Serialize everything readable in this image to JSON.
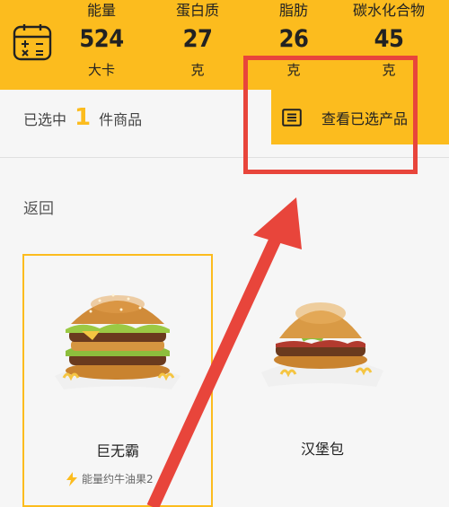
{
  "nutrition": {
    "stats": [
      {
        "label": "能量",
        "value": "524",
        "unit": "大卡"
      },
      {
        "label": "蛋白质",
        "value": "27",
        "unit": "克"
      },
      {
        "label": "脂肪",
        "value": "26",
        "unit": "克"
      },
      {
        "label": "碳水化合物",
        "value": "45",
        "unit": "克"
      }
    ],
    "icon": "calculator-icon",
    "bg_color": "#FCBC1E"
  },
  "selection": {
    "prefix": "已选中",
    "count": "1",
    "suffix": "件商品",
    "view_button_label": "查看已选产品",
    "view_button_icon": "list-icon"
  },
  "back_label": "返回",
  "products": [
    {
      "name": "巨无霸",
      "note": "能量约牛油果2",
      "selected": true
    },
    {
      "name": "汉堡包",
      "selected": false
    }
  ],
  "annotation_color": "#E8453B"
}
